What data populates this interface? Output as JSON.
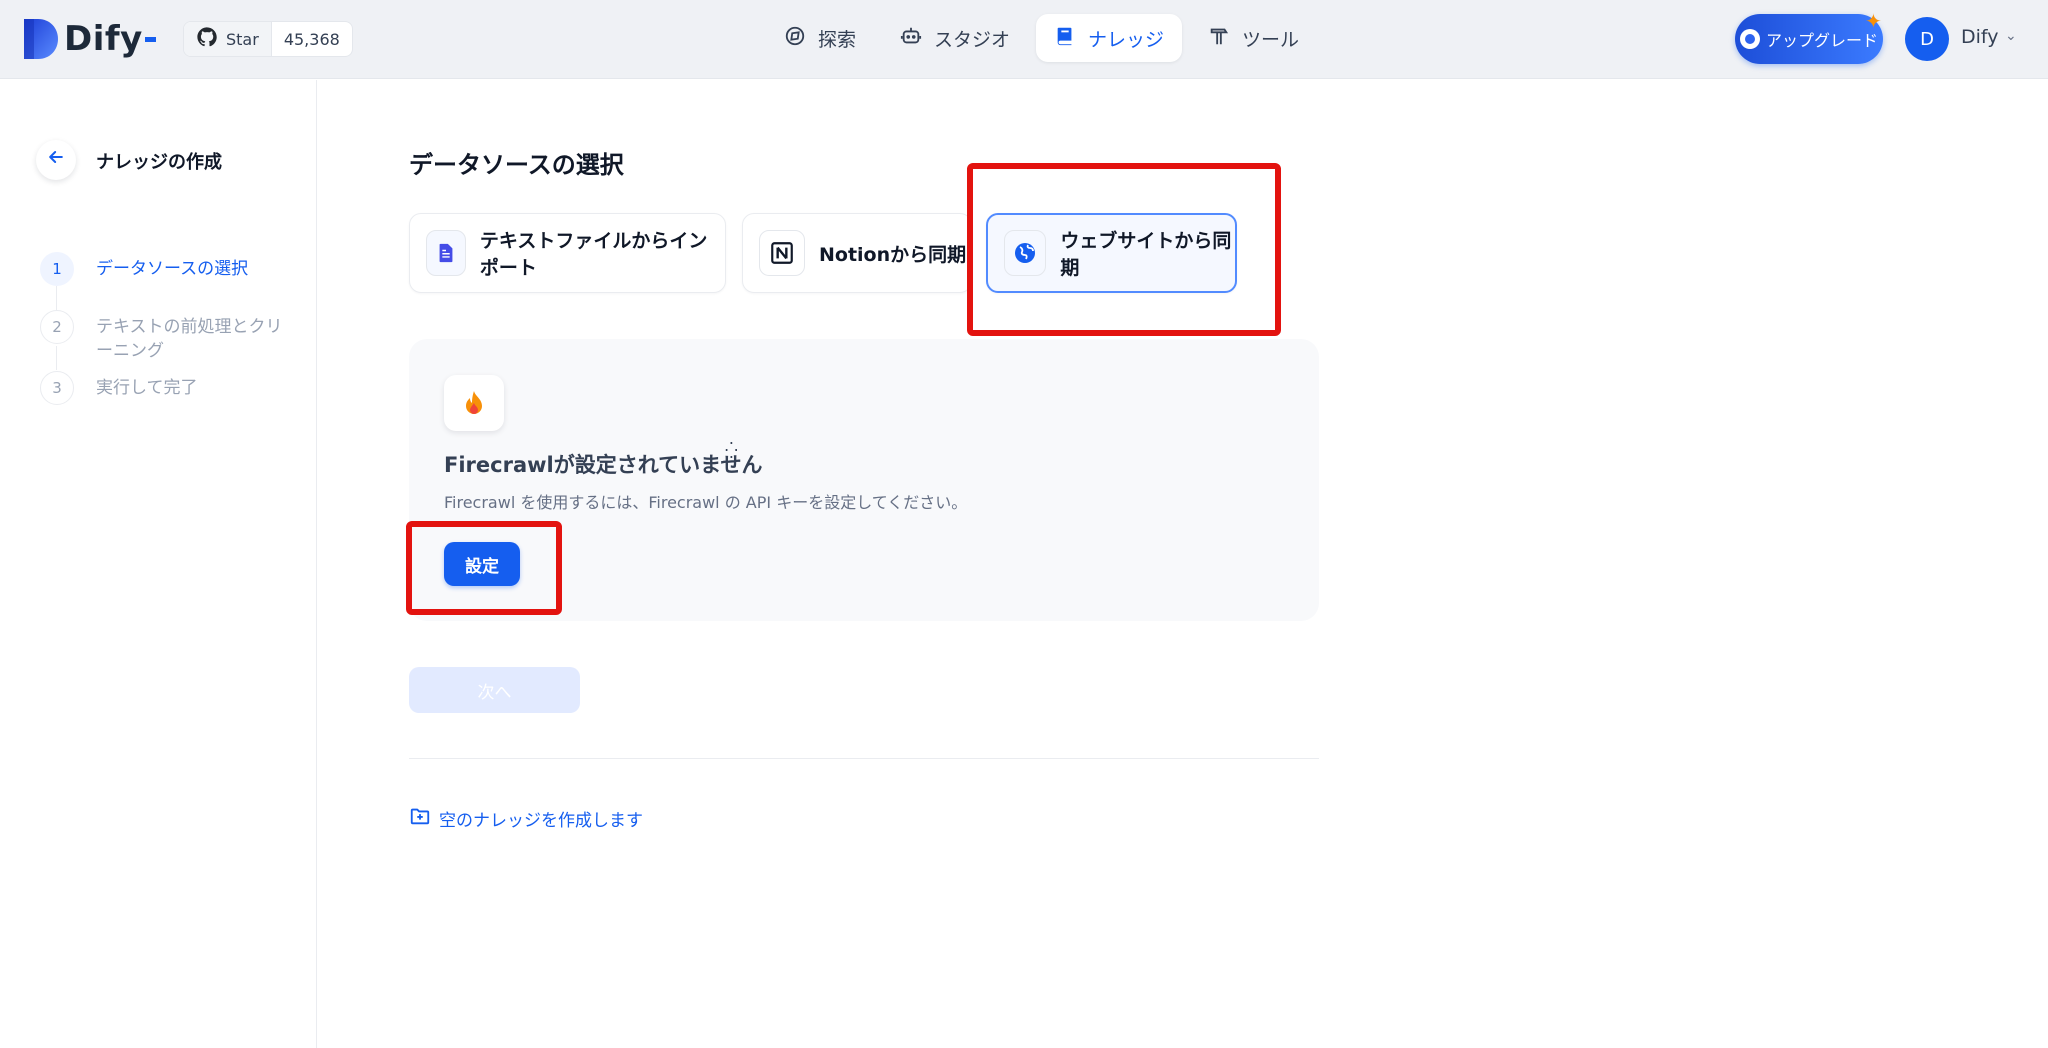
{
  "header": {
    "logo_text": "Dify",
    "github": {
      "star_label": "Star",
      "star_count": "45,368"
    },
    "nav": [
      {
        "label": "探索",
        "icon": "compass-icon"
      },
      {
        "label": "スタジオ",
        "icon": "robot-icon"
      },
      {
        "label": "ナレッジ",
        "icon": "book-icon",
        "active": true
      },
      {
        "label": "ツール",
        "icon": "hammer-icon"
      }
    ],
    "upgrade_label": "アップグレード",
    "avatar_initial": "D",
    "user_name": "Dify"
  },
  "sidebar": {
    "title": "ナレッジの作成",
    "steps": [
      {
        "num": "1",
        "label": "データソースの選択",
        "active": true
      },
      {
        "num": "2",
        "label": "テキストの前処理とクリーニング",
        "active": false
      },
      {
        "num": "3",
        "label": "実行して完了",
        "active": false
      }
    ]
  },
  "main": {
    "title": "データソースの選択",
    "sources": [
      {
        "label": "テキストファイルからインポート",
        "icon": "file-text-icon"
      },
      {
        "label": "Notionから同期",
        "icon": "notion-icon"
      },
      {
        "label": "ウェブサイトから同期",
        "icon": "globe-icon",
        "selected": true
      }
    ],
    "firecrawl": {
      "title": "Firecrawlが設定されていません",
      "description": "Firecrawl を使用するには、Firecrawl の API キーを設定してください。",
      "configure_label": "設定"
    },
    "next_label": "次へ",
    "empty_link": "空のナレッジを作成します"
  },
  "colors": {
    "accent": "#155eef",
    "highlight_box": "#e3130f"
  }
}
